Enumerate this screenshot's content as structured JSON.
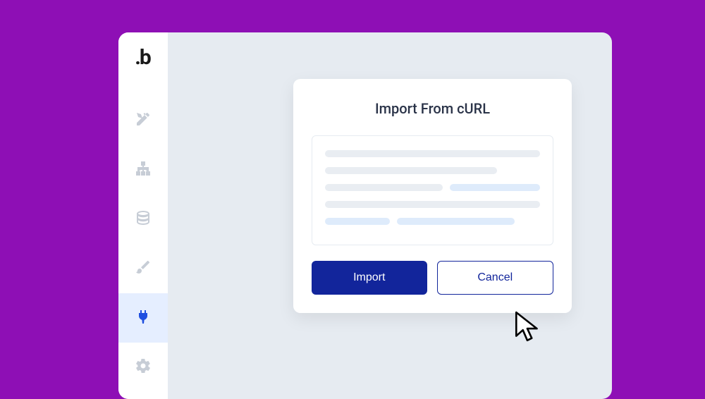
{
  "modal": {
    "title": "Import From cURL",
    "importLabel": "Import",
    "cancelLabel": "Cancel"
  },
  "sidebar": {
    "items": [
      {
        "name": "design"
      },
      {
        "name": "workflow"
      },
      {
        "name": "data"
      },
      {
        "name": "styles"
      },
      {
        "name": "plugins",
        "active": true
      },
      {
        "name": "settings"
      }
    ]
  }
}
